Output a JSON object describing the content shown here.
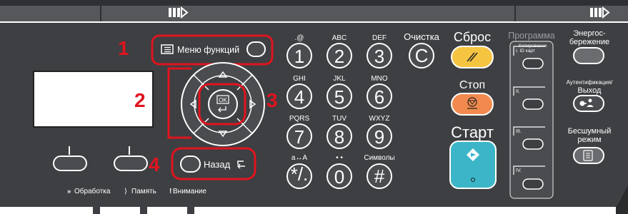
{
  "colors": {
    "panel": "#3d3f42",
    "panel_light": "#6a6c70",
    "highlight": "#e0141e",
    "reset_btn": "#f5c542",
    "stop_btn": "#f28a4e",
    "start_btn": "#3cb5c8",
    "key_fill": "#4a4c50"
  },
  "callouts": [
    "1",
    "2",
    "3",
    "4"
  ],
  "menu_button": {
    "label": "Меню функций"
  },
  "keypad": {
    "keys": [
      {
        "num": "1",
        "sub": ".@"
      },
      {
        "num": "2",
        "sub": "ABC"
      },
      {
        "num": "3",
        "sub": "DEF"
      },
      {
        "num": "4",
        "sub": "GHI"
      },
      {
        "num": "5",
        "sub": "JKL"
      },
      {
        "num": "6",
        "sub": "MNO"
      },
      {
        "num": "7",
        "sub": "PQRS"
      },
      {
        "num": "8",
        "sub": "TUV"
      },
      {
        "num": "9",
        "sub": "WXYZ"
      },
      {
        "num": "*/.",
        "sub": "a↔A"
      },
      {
        "num": "0",
        "sub": "• •"
      },
      {
        "num": "#",
        "sub": "Символы"
      }
    ],
    "clear_label": "Очистка",
    "clear_key": "C"
  },
  "controls": {
    "reset_label": "Сброс",
    "stop_label": "Стоп",
    "start_label": "Старт"
  },
  "program": {
    "title": "Программа",
    "slots": [
      "Копирование ID карт",
      "II.",
      "III.",
      "IV."
    ],
    "slot_prefix": "I."
  },
  "right_buttons": {
    "energy_label_1": "Энергос-",
    "energy_label_2": "бережение",
    "auth_label_1": "Аутентификация/",
    "auth_label_2": "Выход",
    "quiet_label_1": "Бесшумный",
    "quiet_label_2": "режим"
  },
  "back_button": {
    "label": "Назад"
  },
  "ok_button": {
    "label": "OK"
  },
  "status": {
    "processing": "Обработка",
    "memory": "Память",
    "attention": "Внимание"
  }
}
